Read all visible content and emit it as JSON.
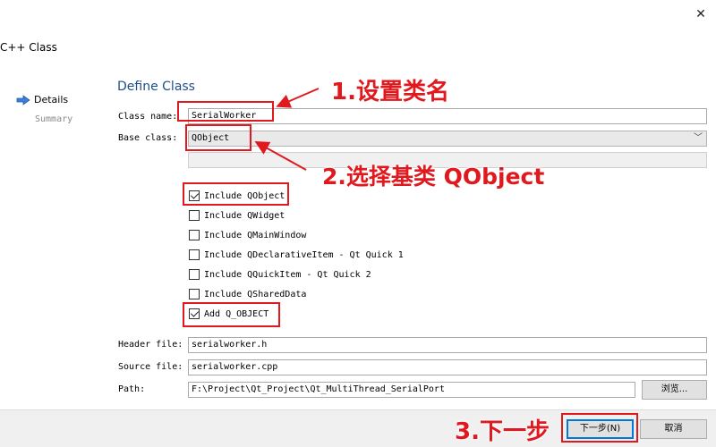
{
  "window": {
    "title": "C++ Class",
    "close_icon": "close-icon"
  },
  "steps": [
    {
      "label": "Details",
      "active": true
    },
    {
      "label": "Summary",
      "active": false
    }
  ],
  "heading": "Define Class",
  "form": {
    "class_name_label": "Class name:",
    "class_name_value": "SerialWorker",
    "base_class_label": "Base class:",
    "base_class_value": "QObject",
    "base_class_extra_value": "",
    "header_file_label": "Header file:",
    "header_file_value": "serialworker.h",
    "source_file_label": "Source file:",
    "source_file_value": "serialworker.cpp",
    "path_label": "Path:",
    "path_value": "F:\\Project\\Qt_Project\\Qt_MultiThread_SerialPort",
    "browse_label": "浏览..."
  },
  "checkboxes": [
    {
      "label": "Include QObject",
      "checked": true
    },
    {
      "label": "Include QWidget",
      "checked": false
    },
    {
      "label": "Include QMainWindow",
      "checked": false
    },
    {
      "label": "Include QDeclarativeItem - Qt Quick 1",
      "checked": false
    },
    {
      "label": "Include QQuickItem - Qt Quick 2",
      "checked": false
    },
    {
      "label": "Include QSharedData",
      "checked": false
    },
    {
      "label": "Add Q_OBJECT",
      "checked": true
    }
  ],
  "buttons": {
    "next_label": "下一步(N)",
    "cancel_label": "取消"
  },
  "annotations": {
    "step1": "1.设置类名",
    "step2": "2.选择基类 QObject",
    "step3": "3.下一步"
  },
  "colors": {
    "annotation": "#e0191f",
    "heading": "#1f4e8c",
    "step_arrow": "#3a7fd5"
  }
}
